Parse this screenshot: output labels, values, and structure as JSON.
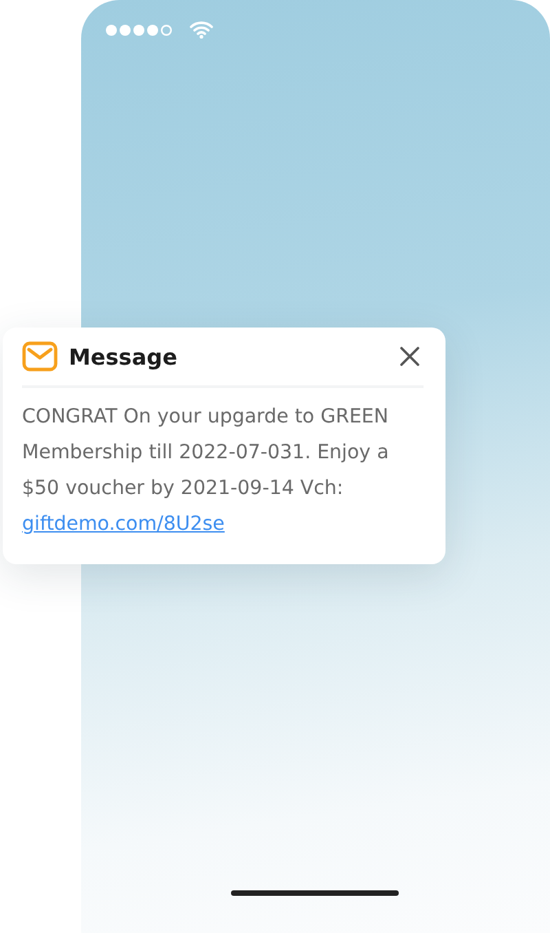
{
  "notification": {
    "title": "Message",
    "body": "CONGRAT On your upgarde to GREEN Membership till 2022-07-031. Enjoy a $50 voucher by 2021-09-14 Vch:",
    "link": "giftdemo.com/8U2se"
  }
}
